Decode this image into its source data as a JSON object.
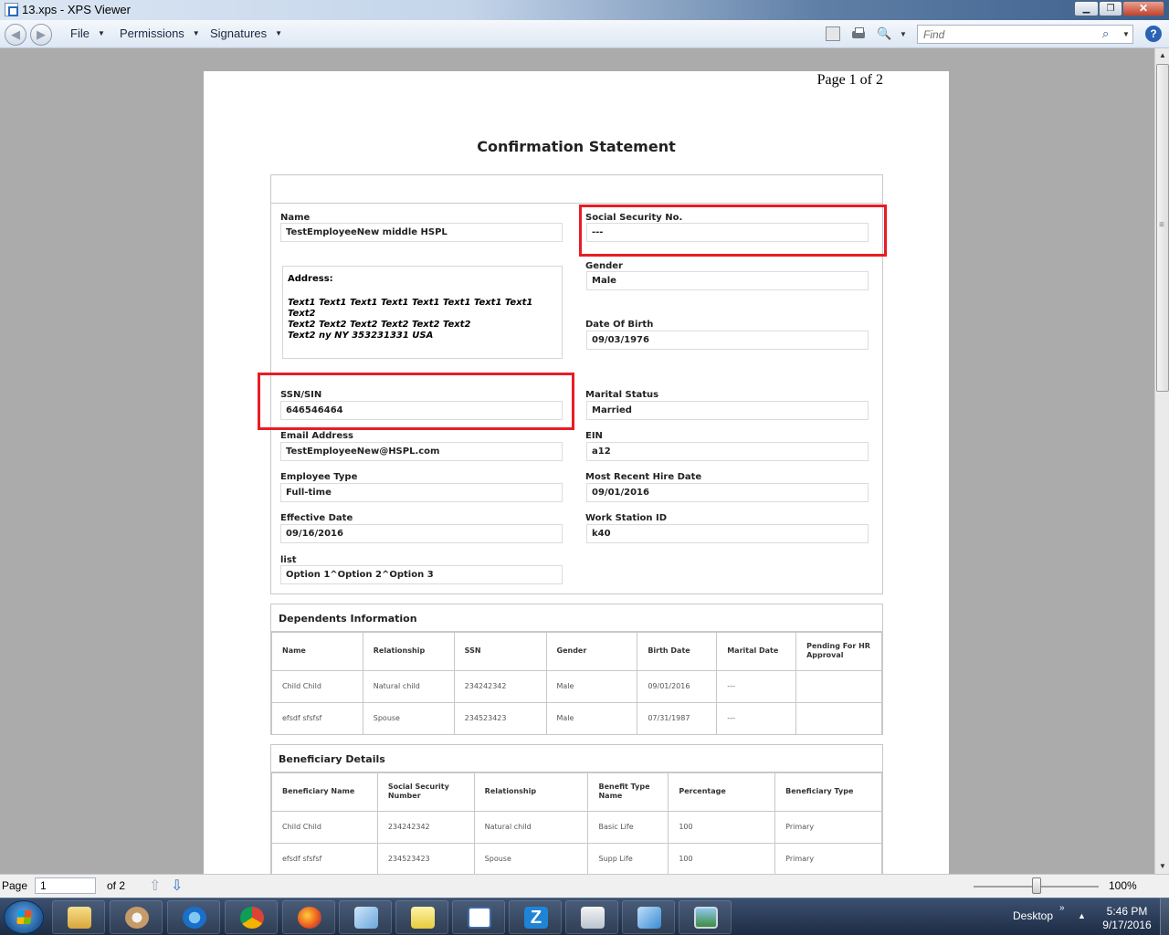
{
  "window": {
    "title": "13.xps - XPS Viewer",
    "minimize": "▁",
    "maximize": "❐",
    "close": "✕"
  },
  "toolbar": {
    "menus": [
      {
        "label": "File",
        "arrow": "▼"
      },
      {
        "label": "Permissions",
        "arrow": "▼"
      },
      {
        "label": "Signatures",
        "arrow": "▼"
      }
    ],
    "find_placeholder": "Find",
    "help": "?",
    "zoom_icon": "🔍",
    "dropdown_arrow": "▼",
    "icons": [
      "back-icon",
      "forward-icon",
      "reading-view-icon",
      "print-icon",
      "zoom-icon",
      "search-icon",
      "help-icon"
    ]
  },
  "document": {
    "page_label": "Page 1 of 2",
    "title": "Confirmation Statement",
    "fields": {
      "name": {
        "label": "Name",
        "value": "TestEmployeeNew middle HSPL"
      },
      "ssn_no": {
        "label": "Social Security No.",
        "value": "---"
      },
      "address": {
        "label": "Address:",
        "lines": [
          "Text1 Text1 Text1 Text1 Text1 Text1 Text1 Text1 Text2",
          "Text2 Text2 Text2 Text2 Text2 Text2",
          "Text2 ny NY 353231331 USA"
        ]
      },
      "gender": {
        "label": "Gender",
        "value": "Male"
      },
      "dob": {
        "label": "Date Of Birth",
        "value": "09/03/1976"
      },
      "ssn_sin": {
        "label": "SSN/SIN",
        "value": "646546464"
      },
      "marital": {
        "label": "Marital Status",
        "value": "Married"
      },
      "email": {
        "label": "Email Address",
        "value": "TestEmployeeNew@HSPL.com"
      },
      "ein": {
        "label": "EIN",
        "value": "a12"
      },
      "emp_type": {
        "label": "Employee Type",
        "value": "Full-time"
      },
      "hire_date": {
        "label": "Most Recent Hire Date",
        "value": "09/01/2016"
      },
      "eff_date": {
        "label": "Effective Date",
        "value": "09/16/2016"
      },
      "work_station": {
        "label": "Work Station ID",
        "value": "k40"
      },
      "list": {
        "label": "list",
        "value": "Option 1^Option 2^Option 3"
      }
    },
    "dependents": {
      "title": "Dependents Information",
      "headers": [
        "Name",
        "Relationship",
        "SSN",
        "Gender",
        "Birth Date",
        "Marital Date",
        "Pending For HR Approval"
      ],
      "rows": [
        [
          "Child Child",
          "Natural child",
          "234242342",
          "Male",
          "09/01/2016",
          "---",
          ""
        ],
        [
          "efsdf sfsfsf",
          "Spouse",
          "234523423",
          "Male",
          "07/31/1987",
          "---",
          ""
        ]
      ]
    },
    "beneficiary": {
      "title": "Beneficiary Details",
      "headers": [
        "Beneficiary Name",
        "Social Security Number",
        "Relationship",
        "Benefit Type Name",
        "Percentage",
        "Beneficiary Type"
      ],
      "rows": [
        [
          "Child Child",
          "234242342",
          "Natural child",
          "Basic Life",
          "100",
          "Primary"
        ],
        [
          "efsdf sfsfsf",
          "234523423",
          "Spouse",
          "Supp Life",
          "100",
          "Primary"
        ]
      ]
    },
    "highlight_color": "#e81c24"
  },
  "statusbar": {
    "page_label": "Page",
    "page_value": "1",
    "of_label": "of 2",
    "zoom": "100%",
    "zoom_level": 1.0
  },
  "taskbar": {
    "desktop_label": "Desktop",
    "chevron": "»",
    "flag": "▲",
    "time": "5:46 PM",
    "date": "9/17/2016",
    "apps": [
      "file-explorer-icon",
      "paint-icon",
      "internet-explorer-icon",
      "chrome-icon",
      "firefox-icon",
      "notepad-icon",
      "sticky-notes-icon",
      "calendar-icon",
      "z-app-icon",
      "documents-icon",
      "send-icon",
      "photo-viewer-icon"
    ]
  }
}
